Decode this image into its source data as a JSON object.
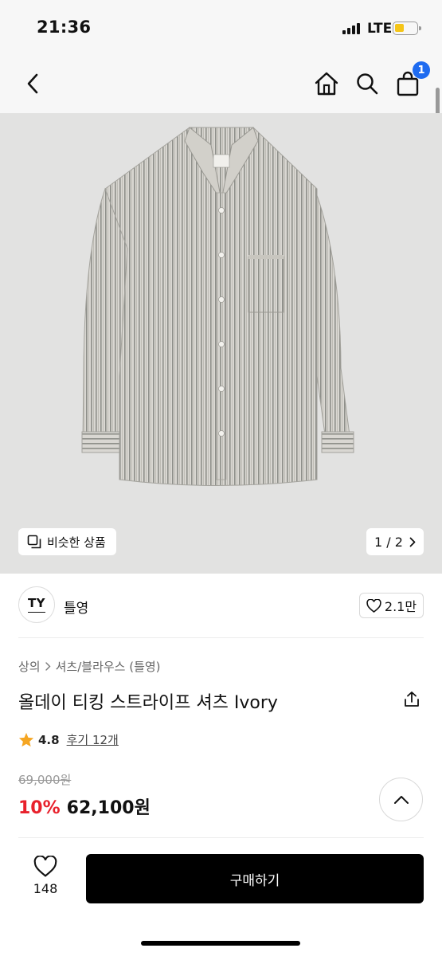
{
  "status": {
    "time": "21:36",
    "network": "LTE"
  },
  "nav": {
    "cart_badge": "1",
    "icons": [
      "back-arrow-icon",
      "home-icon",
      "search-icon",
      "shopping-bag-icon"
    ]
  },
  "gallery": {
    "similar_label": "비슷한 상품",
    "pager": "1 / 2",
    "image_subject": "striped long-sleeve shirt"
  },
  "brand": {
    "logo_text": "TY",
    "name": "틀영",
    "likes": "2.1만"
  },
  "breadcrumb": {
    "category": "상의",
    "subcategory": "셔츠/블라우스 (틀영)"
  },
  "product": {
    "title": "올데이 티킹 스트라이프 셔츠 Ivory",
    "rating": "4.8",
    "reviews": "후기 12개",
    "original_price": "69,000원",
    "discount": "10%",
    "sale_price": "62,100원"
  },
  "bottom_bar": {
    "favorite_count": "148",
    "buy_label": "구매하기"
  },
  "colors": {
    "accent_red": "#e8212c",
    "badge_blue": "#1e6bf0",
    "star": "#f5a623"
  }
}
